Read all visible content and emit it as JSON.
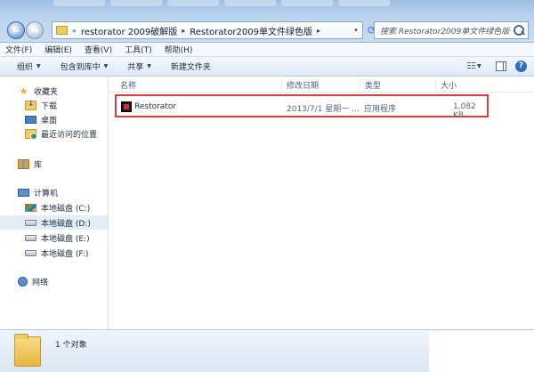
{
  "address": {
    "crumbs": [
      "«",
      "restorator 2009破解版",
      "▸",
      "Restorator2009单文件绿色版",
      "▸"
    ],
    "search_placeholder": "搜索 Restorator2009单文件绿色版"
  },
  "nav_buttons": {
    "back": "←",
    "forward": "→",
    "dropdown": "▾",
    "refresh": "⟳"
  },
  "menu": [
    "文件(F)",
    "编辑(E)",
    "查看(V)",
    "工具(T)",
    "帮助(H)"
  ],
  "commands": [
    {
      "label": "组织",
      "arrow": "▼"
    },
    {
      "label": "包含到库中",
      "arrow": "▼"
    },
    {
      "label": "共享",
      "arrow": "▼"
    },
    {
      "label": "新建文件夹",
      "arrow": ""
    }
  ],
  "view_arrow": "▼",
  "help_label": "?",
  "sidebar": {
    "favorites": {
      "label": "收藏夹",
      "items": [
        "下载",
        "桌面",
        "最近访问的位置"
      ]
    },
    "library": {
      "label": "库"
    },
    "computer": {
      "label": "计算机",
      "drives": [
        "本地磁盘 (C:)",
        "本地磁盘 (D:)",
        "本地磁盘 (E:)",
        "本地磁盘 (F:)"
      ]
    },
    "network": {
      "label": "网络"
    }
  },
  "columns": {
    "name": "名称",
    "date": "修改日期",
    "type": "类型",
    "size": "大小"
  },
  "files": [
    {
      "name": "Restorator",
      "date": "2013/7/1 星期一 ...",
      "type": "应用程序",
      "size": "1,082 KB"
    }
  ],
  "status": {
    "count": "1 个对象"
  }
}
